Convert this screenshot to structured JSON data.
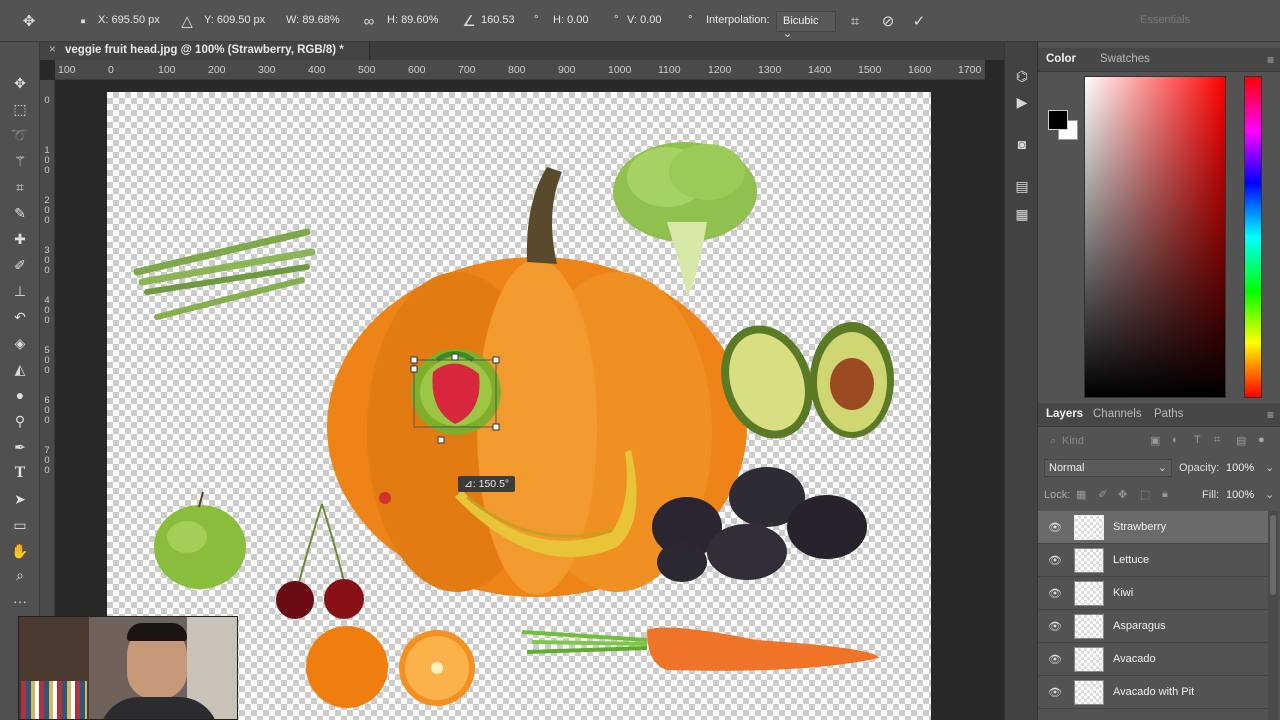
{
  "options_bar": {
    "x_label": "X:",
    "x_value": "695.50 px",
    "y_label": "Y:",
    "y_value": "609.50 px",
    "w_label": "W:",
    "w_value": "89.68%",
    "h_label": "H:",
    "h_value": "89.60%",
    "angle_value": "160.53",
    "hskew_label": "H:",
    "hskew_value": "0.00",
    "vskew_label": "V:",
    "vskew_value": "0.00",
    "interpolation_label": "Interpolation:",
    "interpolation_value": "Bicubic",
    "workspace": "Essentials"
  },
  "document": {
    "tab_title": "veggie fruit head.jpg @ 100% (Strawberry, RGB/8) *",
    "close_glyph": "×",
    "rotation_tooltip": "⊿: 150.5°"
  },
  "ruler": {
    "top_labels": [
      "100",
      "0",
      "100",
      "200",
      "300",
      "400",
      "500",
      "600",
      "700",
      "800",
      "900",
      "1000",
      "1100",
      "1200",
      "1300",
      "1400",
      "1500",
      "1600",
      "1700"
    ],
    "left_labels": [
      "0",
      "1\n0\n0",
      "2\n0\n0",
      "3\n0\n0",
      "4\n0\n0",
      "5\n0\n0",
      "6\n0\n0",
      "7\n0\n0"
    ]
  },
  "tools": [
    "move-icon",
    "marquee-icon",
    "lasso-icon",
    "magic-wand-icon",
    "crop-icon",
    "eyedropper-icon",
    "healing-brush-icon",
    "brush-icon",
    "stamp-icon",
    "history-brush-icon",
    "eraser-icon",
    "gradient-icon",
    "blur-icon",
    "dodge-icon",
    "pen-icon",
    "type-icon",
    "path-select-icon",
    "rectangle-icon",
    "hand-icon",
    "zoom-icon",
    "more-icon"
  ],
  "color_panel": {
    "tabs": [
      "Color",
      "Swatches"
    ],
    "foreground": "#000000",
    "background": "#ffffff",
    "hue_color": "#ff0000"
  },
  "layers_panel": {
    "tabs": [
      "Layers",
      "Channels",
      "Paths"
    ],
    "filter_kind": "Kind",
    "blend_mode": "Normal",
    "opacity_label": "Opacity:",
    "opacity_value": "100%",
    "lock_label": "Lock:",
    "fill_label": "Fill:",
    "fill_value": "100%",
    "layers": [
      {
        "name": "Strawberry",
        "selected": true
      },
      {
        "name": "Lettuce",
        "selected": false
      },
      {
        "name": "Kiwi",
        "selected": false
      },
      {
        "name": "Asparagus",
        "selected": false
      },
      {
        "name": "Avacado",
        "selected": false
      },
      {
        "name": "Avacado with Pit",
        "selected": false
      }
    ]
  },
  "colors": {
    "ui_bg": "#535353",
    "pumpkin": "#f08a1c",
    "strawberry": "#d8263c",
    "kiwi": "#7fae2c"
  }
}
